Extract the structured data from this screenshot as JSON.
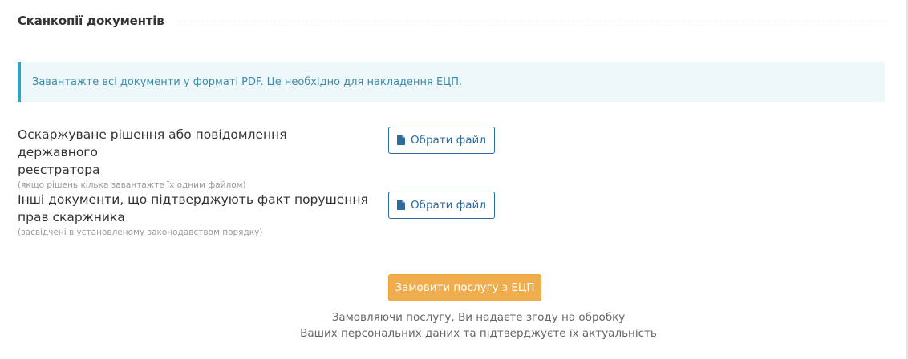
{
  "section": {
    "title": "Сканкопії документів"
  },
  "alert": {
    "text": "Завантажте всі документи у форматі PDF. Це необхідно для накладення ЕЦП."
  },
  "fields": [
    {
      "label_line1": "Оскаржуване рішення або повідомлення державного",
      "label_line2": "реєстратора",
      "hint": "(якщо рішень кілька завантажте їх одним файлом)",
      "button_label": "Обрати файл",
      "button_icon": "file-icon"
    },
    {
      "label_line1": "Інші документи, що підтверджують факт порушення",
      "label_line2": "прав скаржника",
      "hint": "(засвідчені в установленому законодавством порядку)",
      "button_label": "Обрати файл",
      "button_icon": "file-icon"
    }
  ],
  "submit": {
    "label": "Замовити послугу з ЕЦП",
    "color": "#f0ad4e"
  },
  "consent": {
    "line1": "Замовляючи послугу, Ви надаєте згоду на обробку",
    "line2": "Ваших персональних даних та підтверджуєте їх актуальність"
  },
  "colors": {
    "alert_background": "#eef8fb",
    "alert_accent": "#2fa3c0",
    "button_outline": "#2f6a9e"
  }
}
